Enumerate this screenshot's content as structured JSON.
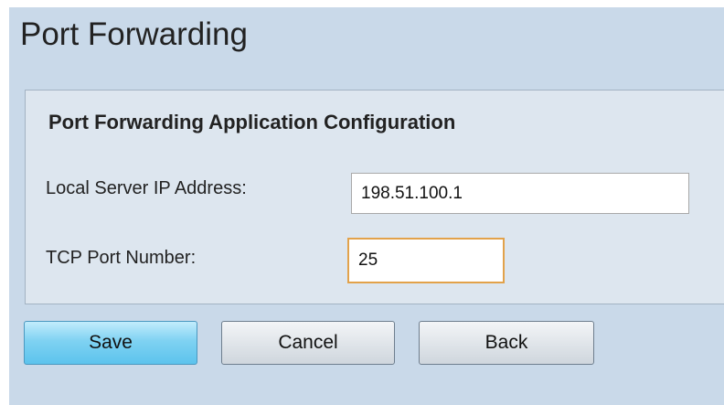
{
  "page": {
    "title": "Port Forwarding"
  },
  "section": {
    "title": "Port Forwarding Application Configuration"
  },
  "fields": {
    "local_server_ip": {
      "label": "Local Server IP Address:",
      "value": "198.51.100.1"
    },
    "tcp_port": {
      "label": "TCP Port Number:",
      "value": "25"
    }
  },
  "buttons": {
    "save": "Save",
    "cancel": "Cancel",
    "back": "Back"
  },
  "colors": {
    "page_background": "#c9d9e9",
    "panel_background": "#dde6ef",
    "save_button": "#5cc3ed",
    "focused_input_border": "#e2a24a"
  }
}
